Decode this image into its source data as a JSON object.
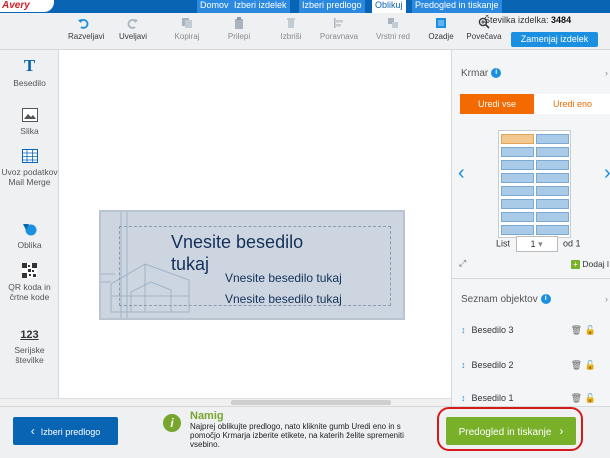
{
  "topbar": {
    "logo": "Avery",
    "steps": [
      "Domov",
      "Izberi izdelek",
      "Izberi predlogo",
      "Oblikuj",
      "Predogled in tiskanje"
    ]
  },
  "toolbar": {
    "undo": "Razveljavi",
    "redo": "Uveljavi",
    "copy": "Kopiraj",
    "paste": "Prilepi",
    "delete": "Izbriši",
    "align": "Poravnava",
    "order": "Vrstni red",
    "background": "Ozadje",
    "zoom": "Povečava",
    "product_label": "Številka izdelka:",
    "product_number": "3484",
    "replace_product": "Zamenjaj izdelek"
  },
  "sidebar": {
    "items": [
      {
        "label": "Besedilo"
      },
      {
        "label": "Slika"
      },
      {
        "label": "Uvoz podatkov Mail Merge"
      },
      {
        "label": "Oblika"
      },
      {
        "label": "QR koda in črtne kode"
      },
      {
        "label": "Serijske številke",
        "glyph": "123"
      }
    ]
  },
  "canvas": {
    "line1": "Vnesite besedilo",
    "line2": "tukaj",
    "line3": "Vnesite besedilo tukaj",
    "line4": "Vnesite besedilo tukaj"
  },
  "navigator": {
    "title": "Krmar",
    "tab_all": "Uredi vse",
    "tab_one": "Uredi eno",
    "sheet_label": "List",
    "sheet_value": "1",
    "of_label": "od 1",
    "add": "Dodaj l"
  },
  "objects": {
    "title": "Seznam objektov",
    "items": [
      "Besedilo 3",
      "Besedilo 2",
      "Besedilo 1"
    ]
  },
  "bottom": {
    "back": "Izberi predlogo",
    "tip_title": "Namig",
    "tip_text": "Najprej oblikujte predlogo, nato kliknite gumb Uredi eno in s pomočjo Krmarja izberite etikete, na katerih želite spremeniti vsebino.",
    "print": "Predogled in tiskanje"
  },
  "colors": {
    "primary": "#0a64b4",
    "accent": "#1b8fe0",
    "orange": "#f26a00",
    "green": "#78b02a",
    "highlight_ring": "#d51a1a"
  }
}
